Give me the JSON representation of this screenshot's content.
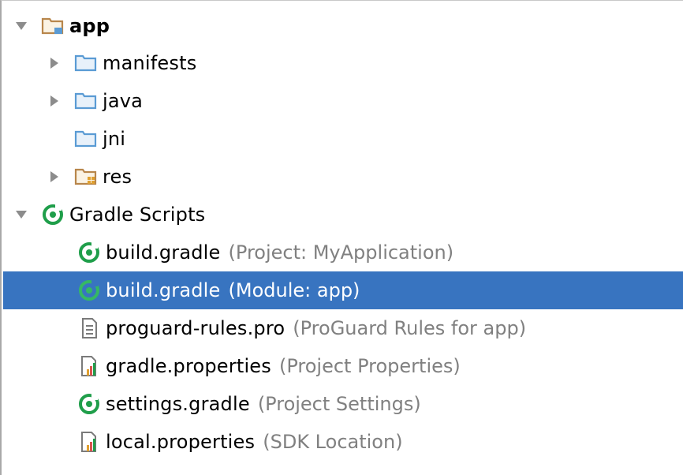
{
  "tree": {
    "app": {
      "label": "app"
    },
    "manifests": {
      "label": "manifests"
    },
    "java": {
      "label": "java"
    },
    "jni": {
      "label": "jni"
    },
    "res": {
      "label": "res"
    },
    "gradle_scripts": {
      "label": "Gradle Scripts"
    },
    "files": [
      {
        "name": "build.gradle",
        "hint": "(Project: MyApplication)",
        "icon": "gradle-icon"
      },
      {
        "name": "build.gradle",
        "hint": "(Module: app)",
        "icon": "gradle-icon"
      },
      {
        "name": "proguard-rules.pro",
        "hint": "(ProGuard Rules for app)",
        "icon": "text-file-icon"
      },
      {
        "name": "gradle.properties",
        "hint": "(Project Properties)",
        "icon": "properties-file-icon"
      },
      {
        "name": "settings.gradle",
        "hint": "(Project Settings)",
        "icon": "gradle-icon"
      },
      {
        "name": "local.properties",
        "hint": "(SDK Location)",
        "icon": "properties-file-icon"
      }
    ]
  },
  "colors": {
    "selection": "#3874c0",
    "folder_blue": "#5a9bd4",
    "gradle_green": "#1f9e4a",
    "hint_gray": "#808080"
  }
}
